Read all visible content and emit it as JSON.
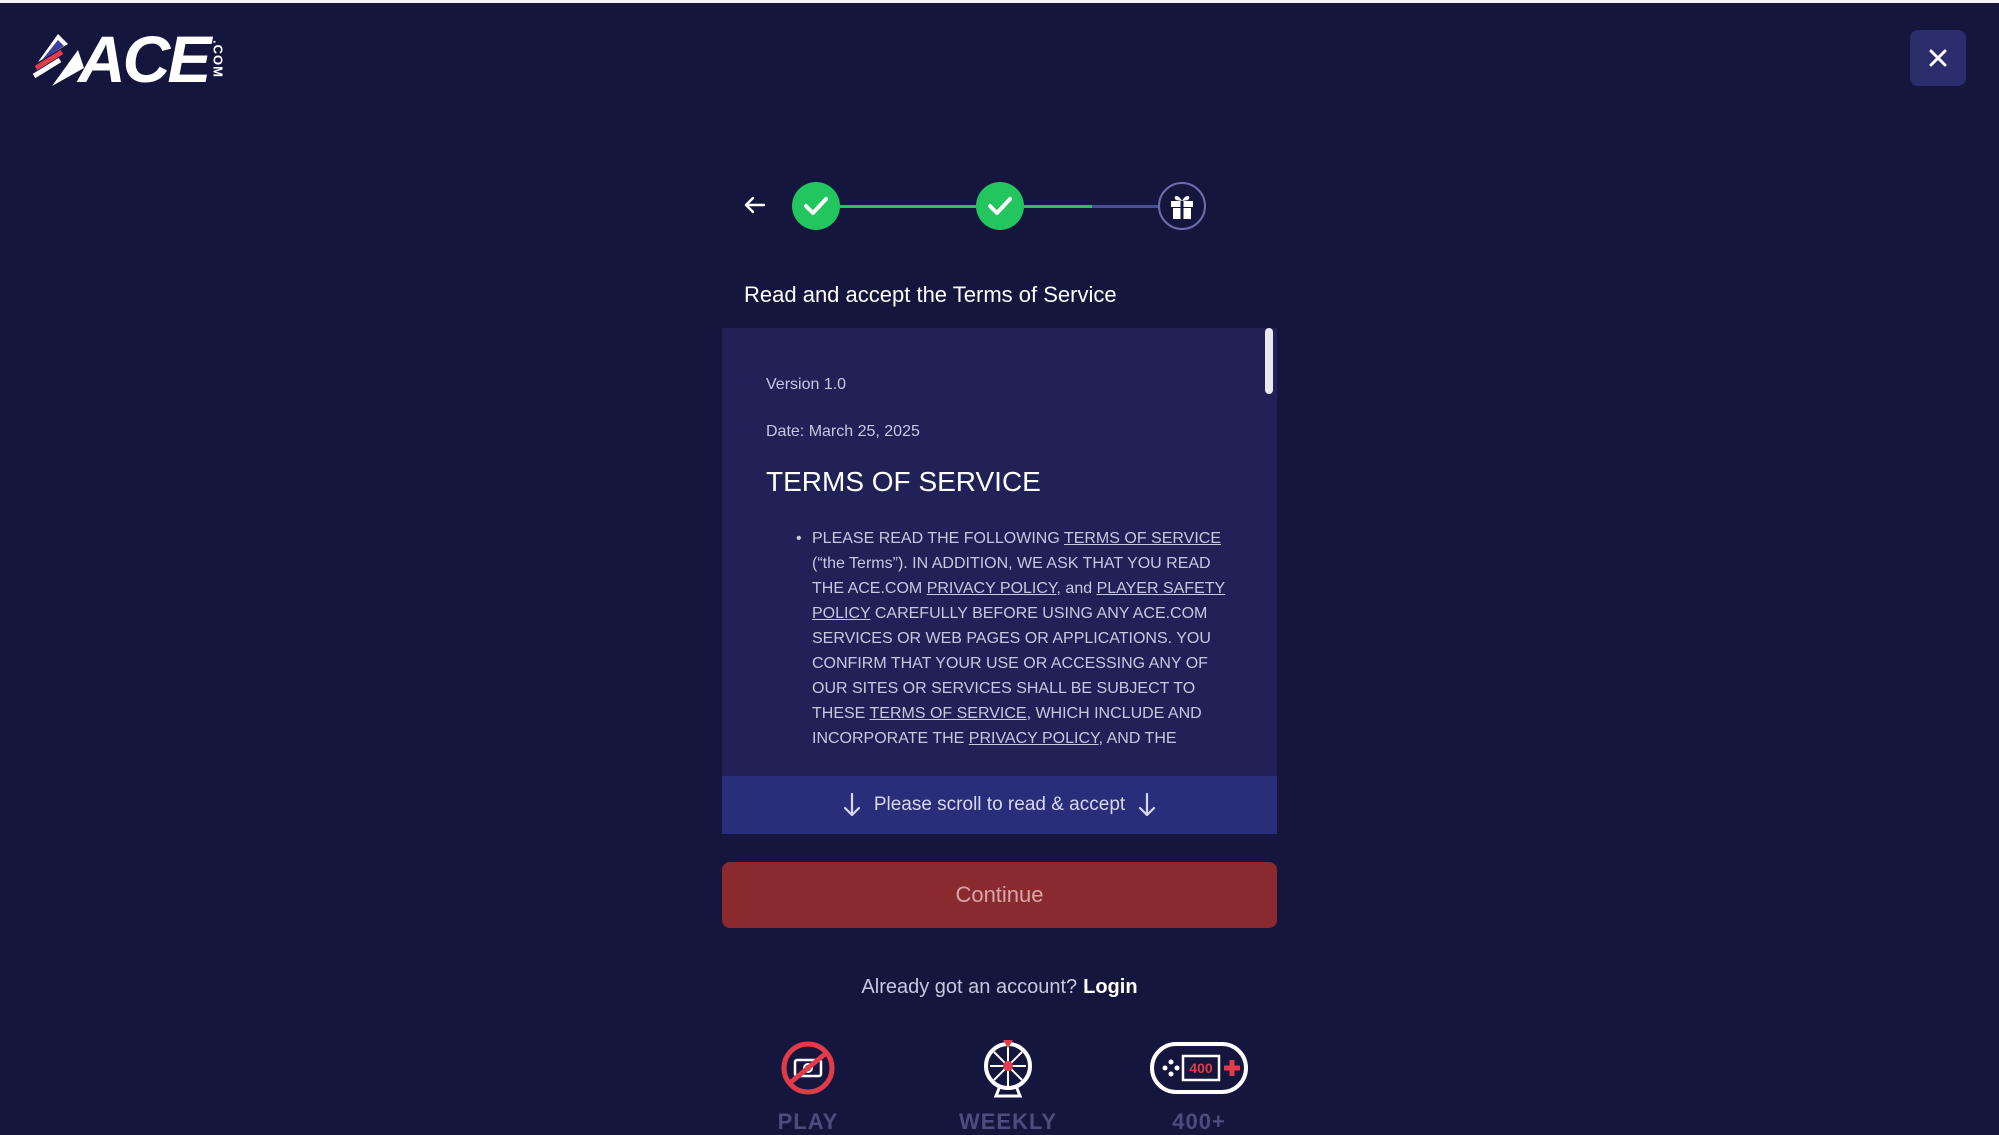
{
  "brand": {
    "name": "ACE",
    "suffix": ".COM"
  },
  "stepper": {
    "steps": [
      {
        "status": "complete"
      },
      {
        "status": "complete"
      },
      {
        "status": "current",
        "icon": "gift-icon"
      }
    ]
  },
  "modal": {
    "title": "Read and accept the Terms of Service",
    "terms": {
      "version": "Version 1.0",
      "date": "Date: March 25, 2025",
      "heading": "TERMS OF SERVICE",
      "paragraph": {
        "t1": "PLEASE READ THE FOLLOWING ",
        "link1": "TERMS OF SERVICE",
        "t2": " (“the Terms”). IN ADDITION, WE ASK THAT YOU READ THE ACE.COM ",
        "link2": "PRIVACY POLICY",
        "t3": ", and ",
        "link3": "PLAYER SAFETY POLICY",
        "t4": " CAREFULLY BEFORE USING ANY ACE.COM SERVICES OR WEB PAGES OR APPLICATIONS. YOU CONFIRM THAT YOUR USE OR ACCESSING ANY OF OUR SITES OR SERVICES SHALL BE SUBJECT TO THESE ",
        "link4": "TERMS OF SERVICE",
        "t5": ", WHICH INCLUDE AND INCORPORATE THE ",
        "link5": "PRIVACY POLICY",
        "t6": ", AND THE"
      }
    },
    "scroll_hint": "Please scroll to read & accept",
    "continue_label": "Continue",
    "account_prompt": "Already got an account?",
    "login_label": "Login"
  },
  "features": [
    {
      "label": "PLAY",
      "icon": "no-money-icon"
    },
    {
      "label": "WEEKLY",
      "icon": "prize-wheel-icon"
    },
    {
      "label": "400+",
      "icon": "gamepad-400-icon"
    }
  ],
  "colors": {
    "background": "#15163d",
    "accent_green": "#22c55e",
    "continue_disabled": "#8b2a2e",
    "terms_panel": "#1f2157",
    "scroll_hint_bg": "#2a2d7a"
  }
}
